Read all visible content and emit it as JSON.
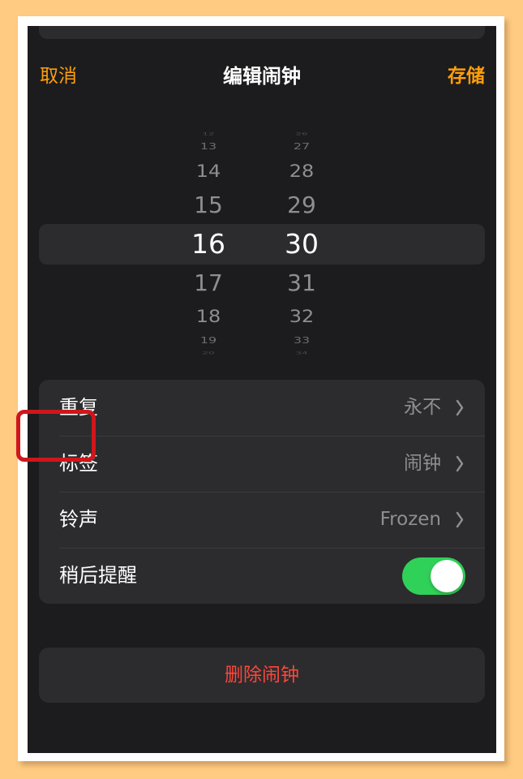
{
  "nav": {
    "cancel": "取消",
    "title": "编辑闹钟",
    "save": "存储"
  },
  "picker": {
    "hours": [
      "12",
      "13",
      "14",
      "15",
      "16",
      "17",
      "18",
      "19",
      "20"
    ],
    "minutes": [
      "26",
      "27",
      "28",
      "29",
      "30",
      "31",
      "32",
      "33",
      "34"
    ]
  },
  "settings": [
    {
      "label": "重复",
      "value": "永不"
    },
    {
      "label": "标签",
      "value": "闹钟"
    },
    {
      "label": "铃声",
      "value": "Frozen"
    },
    {
      "label": "稍后提醒",
      "toggle": true
    }
  ],
  "delete_label": "删除闹钟",
  "colors": {
    "accent": "#FF9F0A",
    "destructive": "#FF453A",
    "toggle_on": "#30D158",
    "highlight": "#D0161B"
  }
}
